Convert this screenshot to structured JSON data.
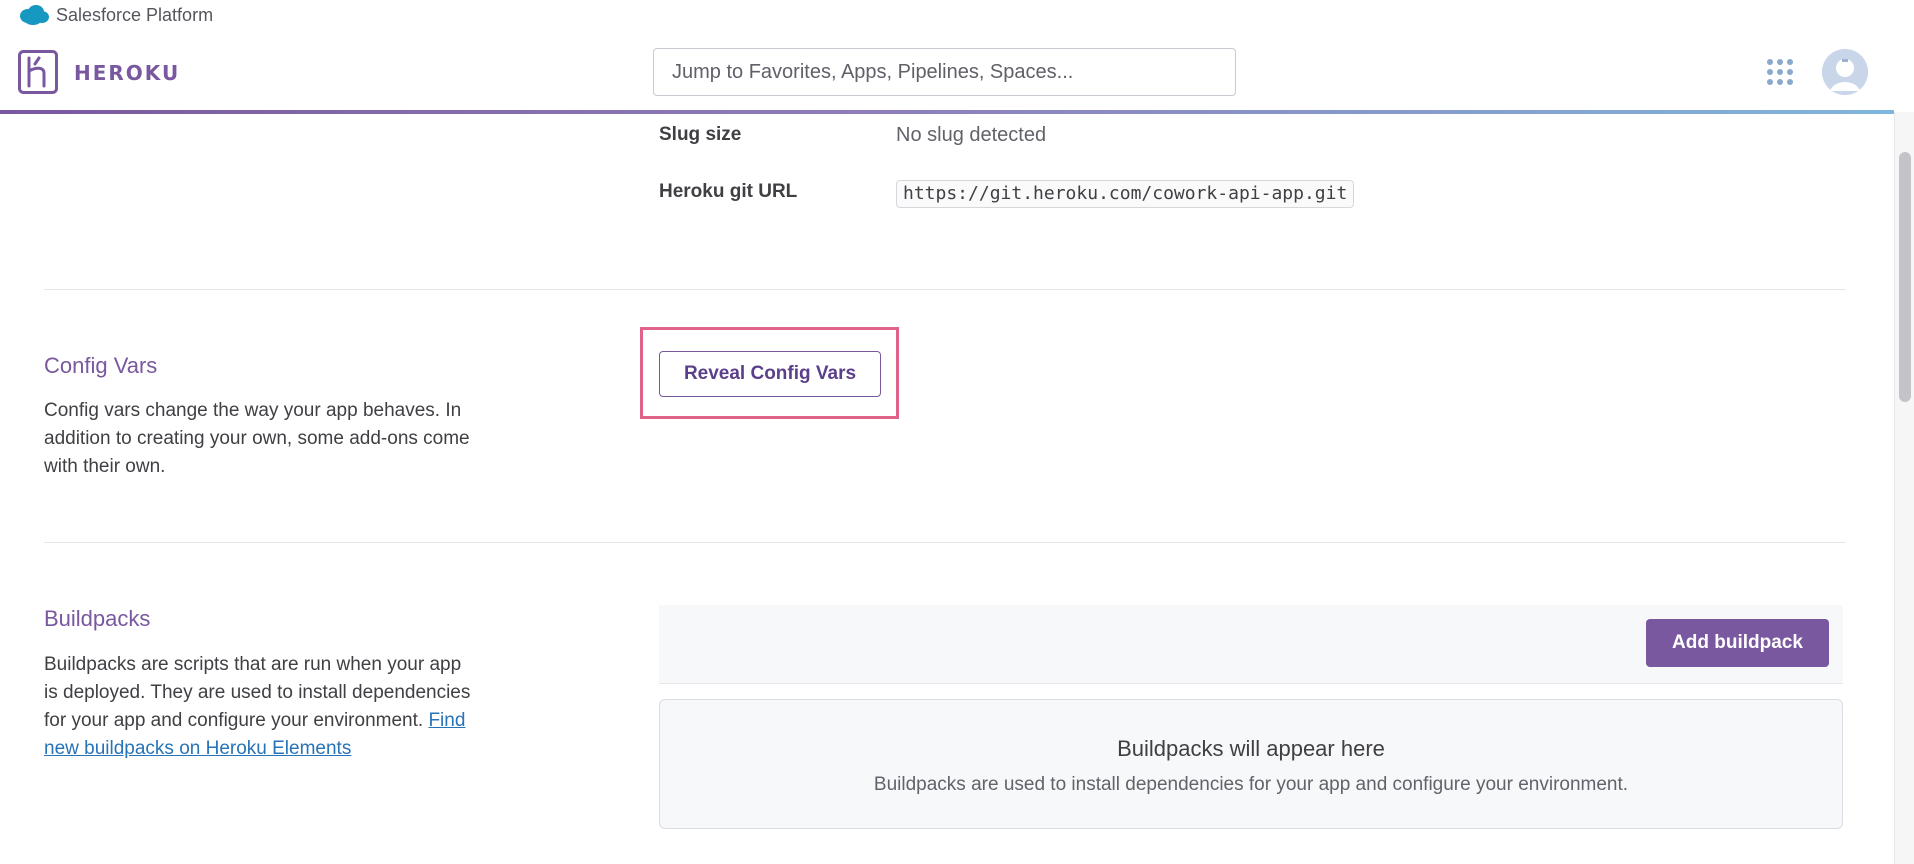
{
  "salesforce_bar": {
    "label": "Salesforce Platform",
    "icon": "salesforce-cloud-icon"
  },
  "header": {
    "brand": "HEROKU",
    "logo_icon": "heroku-logo-icon",
    "search_placeholder": "Jump to Favorites, Apps, Pipelines, Spaces...",
    "apps_icon": "apps-grid-icon",
    "avatar_icon": "user-avatar",
    "accent_color": "#79589f"
  },
  "app_info": {
    "slug_size_label": "Slug size",
    "slug_size_value": "No slug detected",
    "git_url_label": "Heroku git URL",
    "git_url_value": "https://git.heroku.com/cowork-api-app.git"
  },
  "config_vars": {
    "title": "Config Vars",
    "description": "Config vars change the way your app behaves. In addition to creating your own, some add-ons come with their own.",
    "reveal_button": "Reveal Config Vars",
    "highlight_color": "#e0648a"
  },
  "buildpacks": {
    "title": "Buildpacks",
    "description": "Buildpacks are scripts that are run when your app is deployed. They are used to install dependencies for your app and configure your environment.",
    "link_text": "Find new buildpacks on Heroku Elements",
    "add_button": "Add buildpack",
    "empty_title": "Buildpacks will appear here",
    "empty_subtitle": "Buildpacks are used to install dependencies for your app and configure your environment."
  }
}
